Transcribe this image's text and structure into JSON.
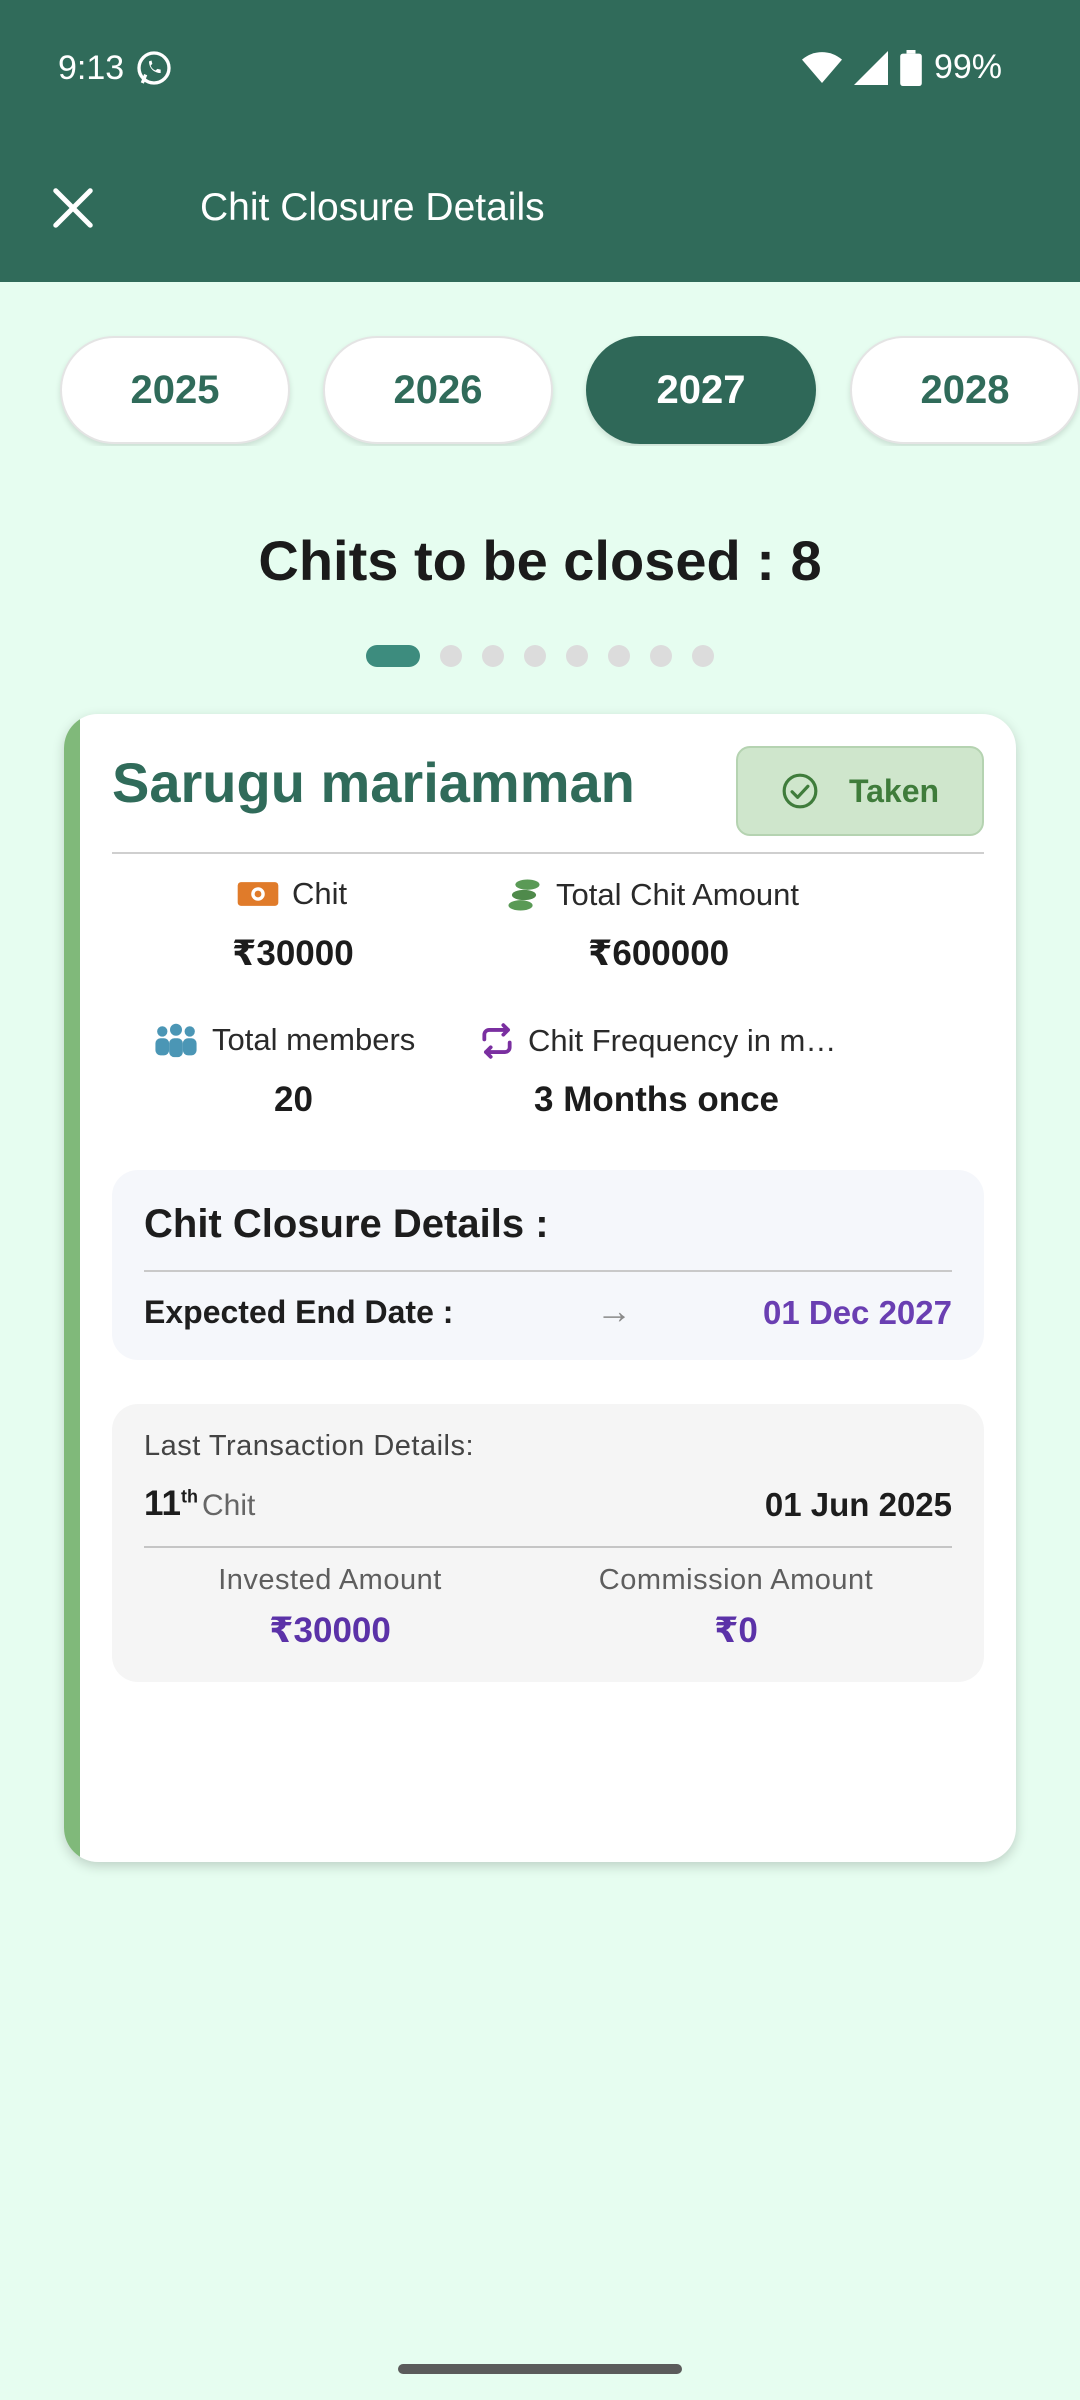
{
  "status_bar": {
    "time": "9:13",
    "battery": "99%"
  },
  "header": {
    "title": "Chit Closure Details"
  },
  "years": [
    {
      "label": "2025",
      "active": false
    },
    {
      "label": "2026",
      "active": false
    },
    {
      "label": "2027",
      "active": true
    },
    {
      "label": "2028",
      "active": false
    }
  ],
  "summary": {
    "heading": "Chits to be closed :  8"
  },
  "pager": {
    "total_dots": 8,
    "active_index": 0
  },
  "card": {
    "name": "Sarugu mariamman",
    "badge": "Taken",
    "chit_label": "Chit",
    "chit_value": "₹30000",
    "total_amount_label": "Total Chit Amount",
    "total_amount_value": "₹600000",
    "members_label": "Total members",
    "members_value": "20",
    "frequency_label": "Chit Frequency in m…",
    "frequency_value": "3  Months once",
    "closure": {
      "title": "Chit Closure Details :",
      "expected_label": "Expected End Date :",
      "arrow": "→",
      "expected_date": "01 Dec 2027"
    },
    "transaction": {
      "title": "Last Transaction Details:",
      "chit_number": "11",
      "chit_suffix": "th",
      "chit_word": "Chit",
      "date": "01 Jun 2025",
      "invested_label": "Invested Amount",
      "invested_value": "₹30000",
      "commission_label": "Commission Amount",
      "commission_value": "₹0"
    }
  },
  "colors": {
    "primary": "#306b5a",
    "background": "#e6fdf0",
    "accent_purple": "#6a3fb2",
    "badge_green": "#cfe6cc",
    "stripe": "#80b97a"
  }
}
